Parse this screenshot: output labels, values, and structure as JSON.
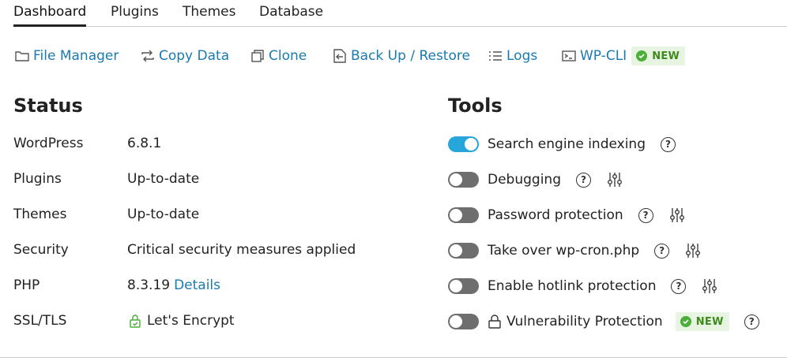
{
  "tabs": [
    {
      "label": "Dashboard",
      "active": true
    },
    {
      "label": "Plugins"
    },
    {
      "label": "Themes"
    },
    {
      "label": "Database"
    }
  ],
  "toolbar": {
    "file_manager": "File Manager",
    "copy_data": "Copy Data",
    "clone": "Clone",
    "backup_restore": "Back Up / Restore",
    "logs": "Logs",
    "wp_cli": "WP-CLI",
    "new_badge": "NEW"
  },
  "status": {
    "title": "Status",
    "rows": [
      {
        "label": "WordPress",
        "value": "6.8.1"
      },
      {
        "label": "Plugins",
        "value": "Up-to-date"
      },
      {
        "label": "Themes",
        "value": "Up-to-date"
      },
      {
        "label": "Security",
        "value": "Critical security measures applied"
      },
      {
        "label": "PHP",
        "value": "8.3.19",
        "link": "Details"
      },
      {
        "label": "SSL/TLS",
        "value": "Let's Encrypt"
      }
    ]
  },
  "tools": {
    "title": "Tools",
    "rows": [
      {
        "label": "Search engine indexing",
        "enabled": true
      },
      {
        "label": "Debugging",
        "enabled": false
      },
      {
        "label": "Password protection",
        "enabled": false
      },
      {
        "label": "Take over wp-cron.php",
        "enabled": false
      },
      {
        "label": "Enable hotlink protection",
        "enabled": false
      },
      {
        "label": "Vulnerability Protection",
        "enabled": false,
        "badge": "NEW"
      }
    ],
    "help_glyph": "?"
  },
  "colors": {
    "link": "#1a7ab0",
    "toggle_on": "#27a6dc",
    "toggle_off": "#6e6e6e",
    "badge_bg": "#e7f4e1",
    "badge_text": "#3d8b1d"
  }
}
